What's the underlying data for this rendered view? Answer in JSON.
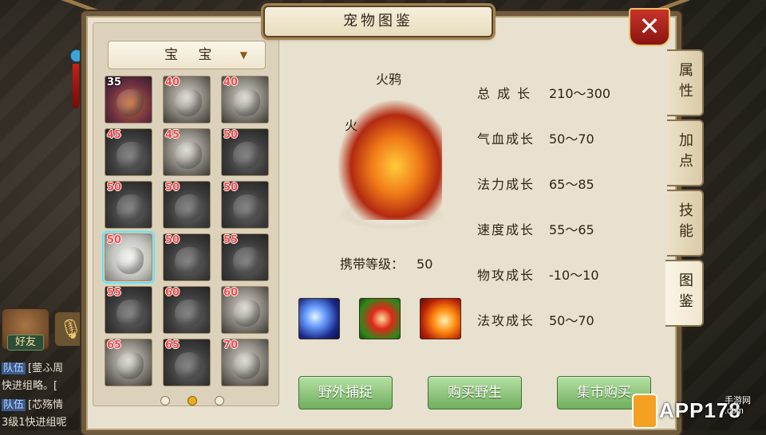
{
  "window": {
    "title": "宠物图鉴",
    "close_label": "✕"
  },
  "filter": {
    "selected": "宝  宝",
    "arrow": "▼"
  },
  "pets": [
    {
      "level": "35",
      "style": "gold",
      "selected": false
    },
    {
      "level": "40",
      "style": "face",
      "selected": false
    },
    {
      "level": "40",
      "style": "face",
      "selected": false
    },
    {
      "level": "45",
      "style": "dark",
      "selected": false
    },
    {
      "level": "45",
      "style": "face",
      "selected": false
    },
    {
      "level": "50",
      "style": "dark",
      "selected": false
    },
    {
      "level": "50",
      "style": "dark",
      "selected": false
    },
    {
      "level": "50",
      "style": "dark",
      "selected": false
    },
    {
      "level": "50",
      "style": "dark",
      "selected": false
    },
    {
      "level": "50",
      "style": "pale",
      "selected": true
    },
    {
      "level": "50",
      "style": "dark",
      "selected": false
    },
    {
      "level": "55",
      "style": "dark",
      "selected": false
    },
    {
      "level": "55",
      "style": "dark",
      "selected": false
    },
    {
      "level": "60",
      "style": "dark",
      "selected": false
    },
    {
      "level": "60",
      "style": "face",
      "selected": false
    },
    {
      "level": "65",
      "style": "face",
      "selected": false
    },
    {
      "level": "65",
      "style": "dark",
      "selected": false
    },
    {
      "level": "70",
      "style": "face",
      "selected": false
    }
  ],
  "pager": {
    "pages": 3,
    "current": 1
  },
  "detail": {
    "name": "火鸦",
    "element": "火",
    "carry_label": "携带等级：",
    "carry_value": "50",
    "skills": [
      "skill-icon-1",
      "skill-icon-2",
      "skill-icon-3"
    ]
  },
  "stats": [
    {
      "label": "总 成 长",
      "value": "210～300"
    },
    {
      "label": "气血成长",
      "value": "50～70"
    },
    {
      "label": "法力成长",
      "value": "65～85"
    },
    {
      "label": "速度成长",
      "value": "55～65"
    },
    {
      "label": "物攻成长",
      "value": "-10～10"
    },
    {
      "label": "法攻成长",
      "value": "50～70"
    }
  ],
  "actions": {
    "catch": "野外捕捉",
    "buy_wild": "购买野生",
    "market_buy": "集市购买"
  },
  "tabs": [
    {
      "label": "属性",
      "active": false
    },
    {
      "label": "加点",
      "active": false
    },
    {
      "label": "技能",
      "active": false
    },
    {
      "label": "图鉴",
      "active": true
    }
  ],
  "chat": {
    "friend_label": "好友",
    "mic_icon": "microphone-icon",
    "lines": [
      {
        "tag": "队伍",
        "text": "[蓥ふ周"
      },
      {
        "tag": "",
        "text": "快进组略。["
      },
      {
        "tag": "队伍",
        "text": "[芯殇情"
      },
      {
        "tag": "",
        "text": "3级1快进组呢"
      }
    ]
  },
  "watermark": {
    "text": "APP178",
    "sub": "手游网",
    "domain": ".com"
  }
}
